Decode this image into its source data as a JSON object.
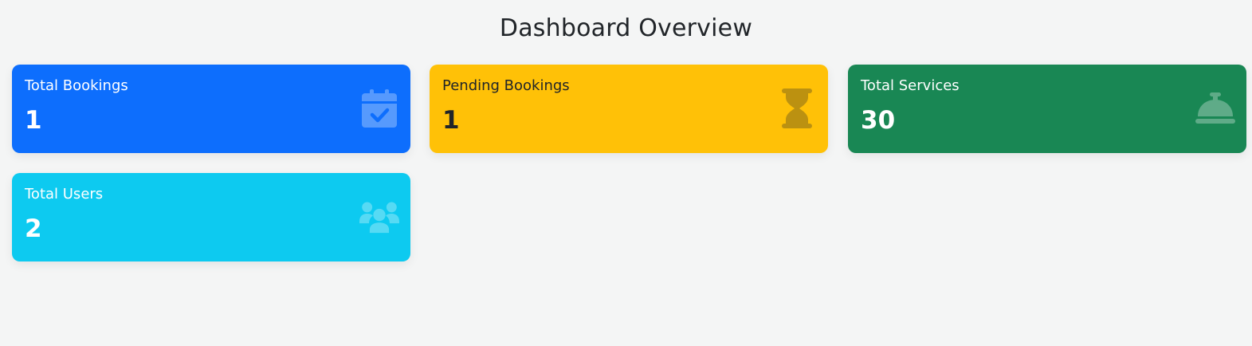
{
  "page": {
    "title": "Dashboard Overview"
  },
  "cards": [
    {
      "label": "Total Bookings",
      "value": "1",
      "icon": "calendar-check-icon",
      "bg": "#0d6efd",
      "fg": "#ffffff",
      "icon_color": "#ffffff"
    },
    {
      "label": "Pending Bookings",
      "value": "1",
      "icon": "hourglass-icon",
      "bg": "#ffc107",
      "fg": "#212529",
      "icon_color": "#212529"
    },
    {
      "label": "Total Services",
      "value": "30",
      "icon": "concierge-bell-icon",
      "bg": "#198754",
      "fg": "#ffffff",
      "icon_color": "#ffffff"
    },
    {
      "label": "Total Users",
      "value": "2",
      "icon": "users-icon",
      "bg": "#0dcaf0",
      "fg": "#ffffff",
      "icon_color": "#ffffff"
    }
  ]
}
